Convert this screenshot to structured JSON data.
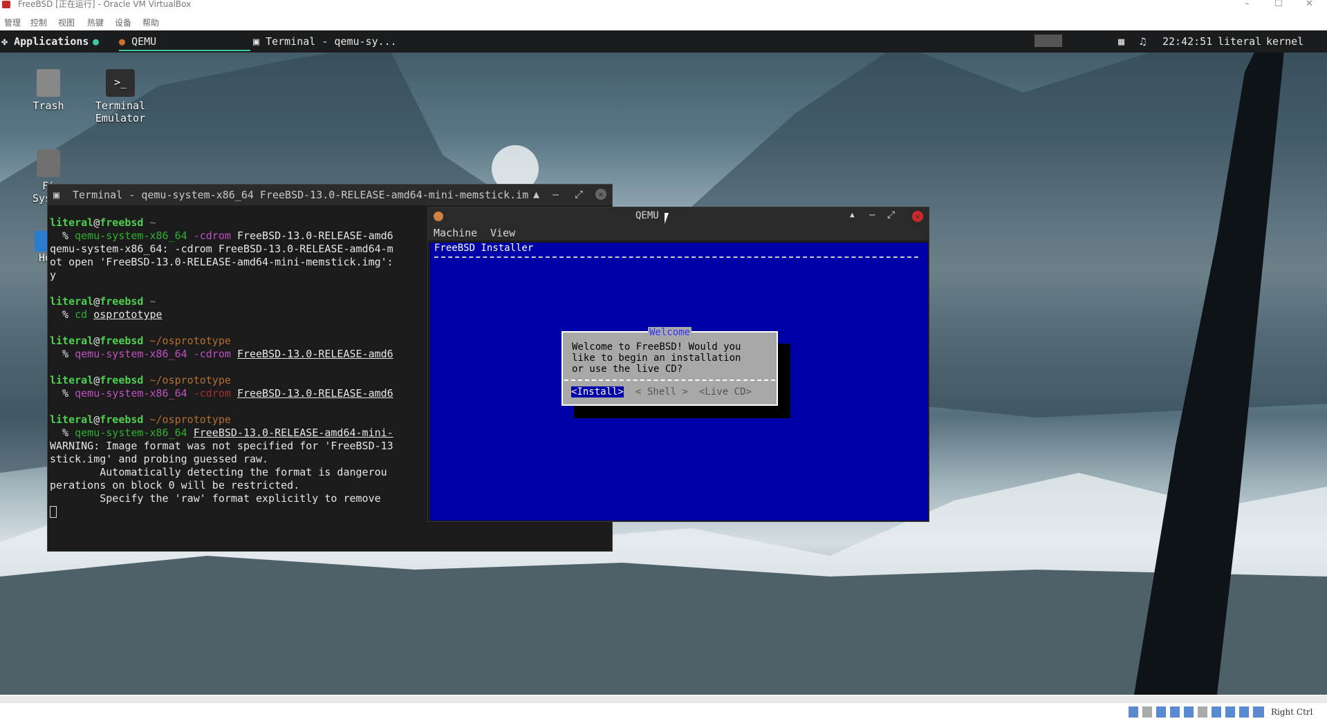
{
  "vbox": {
    "title": "FreeBSD [正在运行] - Oracle VM VirtualBox",
    "menu": [
      "管理",
      "控制",
      "视图",
      "热键",
      "设备",
      "帮助"
    ],
    "host_key": "Right Ctrl"
  },
  "panel": {
    "applications": "Applications",
    "task_qemu": "QEMU",
    "task_terminal": "Terminal - qemu-sy...",
    "clock": "22:42:51",
    "user": "literal",
    "kernel": "kernel"
  },
  "desktop": {
    "trash": "Trash",
    "terminal1": "Terminal",
    "terminal2": "Emulator",
    "fs1": "Fi",
    "fs2": "Syst",
    "home": "Ho"
  },
  "terminal": {
    "title": "Terminal - qemu-system-x86_64 FreeBSD-13.0-RELEASE-amd64-mini-memstick.im",
    "user": "literal",
    "at": "@",
    "host": "freebsd",
    "home": "~",
    "dir": "~/osprototype",
    "prompt": "  % ",
    "cmd_qemu": "qemu-system-x86_64",
    "cdrom": "-cdrom",
    "img1": "FreeBSD-13.0-RELEASE-amd6",
    "err1": "qemu-system-x86_64: -cdrom FreeBSD-13.0-RELEASE-amd64-m",
    "err2": "ot open 'FreeBSD-13.0-RELEASE-amd64-mini-memstick.img':",
    "err3": "y",
    "cmd_cd": "cd",
    "cd_arg": "osprototype",
    "img2": "FreeBSD-13.0-RELEASE-amd64-mini-",
    "warn1": "WARNING: Image format was not specified for 'FreeBSD-13",
    "warn2": "stick.img' and probing guessed raw.",
    "warn3": "        Automatically detecting the format is dangerou",
    "warn4": "perations on block 0 will be restricted.",
    "warn5": "        Specify the 'raw' format explicitly to remove"
  },
  "qemu": {
    "title": "QEMU",
    "menu_machine": "Machine",
    "menu_view": "View",
    "installer_title": "FreeBSD Installer",
    "dialog_title": "Welcome",
    "dialog_text": "Welcome to FreeBSD! Would you\nlike to begin an installation\nor use the live CD?",
    "btn_install": "<Install>",
    "btn_shell": "< Shell >",
    "btn_live": "<Live CD>"
  }
}
